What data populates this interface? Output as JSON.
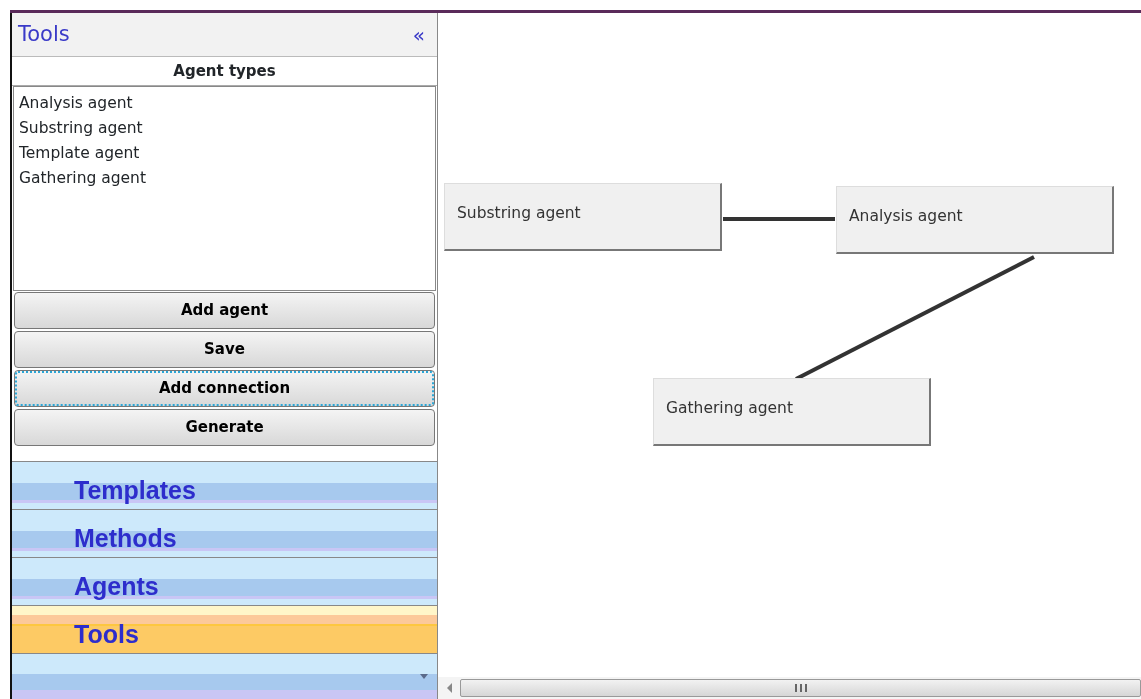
{
  "panel": {
    "title": "Tools",
    "collapse": "«"
  },
  "agent_types": {
    "heading": "Agent types",
    "items": [
      "Analysis agent",
      "Substring agent",
      "Template agent",
      "Gathering agent"
    ]
  },
  "buttons": [
    {
      "label": "Add agent",
      "focused": false
    },
    {
      "label": "Save",
      "focused": false
    },
    {
      "label": "Add connection",
      "focused": true
    },
    {
      "label": "Generate",
      "focused": false
    }
  ],
  "nav": [
    {
      "label": "Templates",
      "selected": false
    },
    {
      "label": "Methods",
      "selected": false
    },
    {
      "label": "Agents",
      "selected": false
    },
    {
      "label": "Tools",
      "selected": true
    }
  ],
  "canvas": {
    "nodes": [
      {
        "label": "Substring agent"
      },
      {
        "label": "Analysis agent"
      },
      {
        "label": "Gathering agent"
      }
    ]
  }
}
